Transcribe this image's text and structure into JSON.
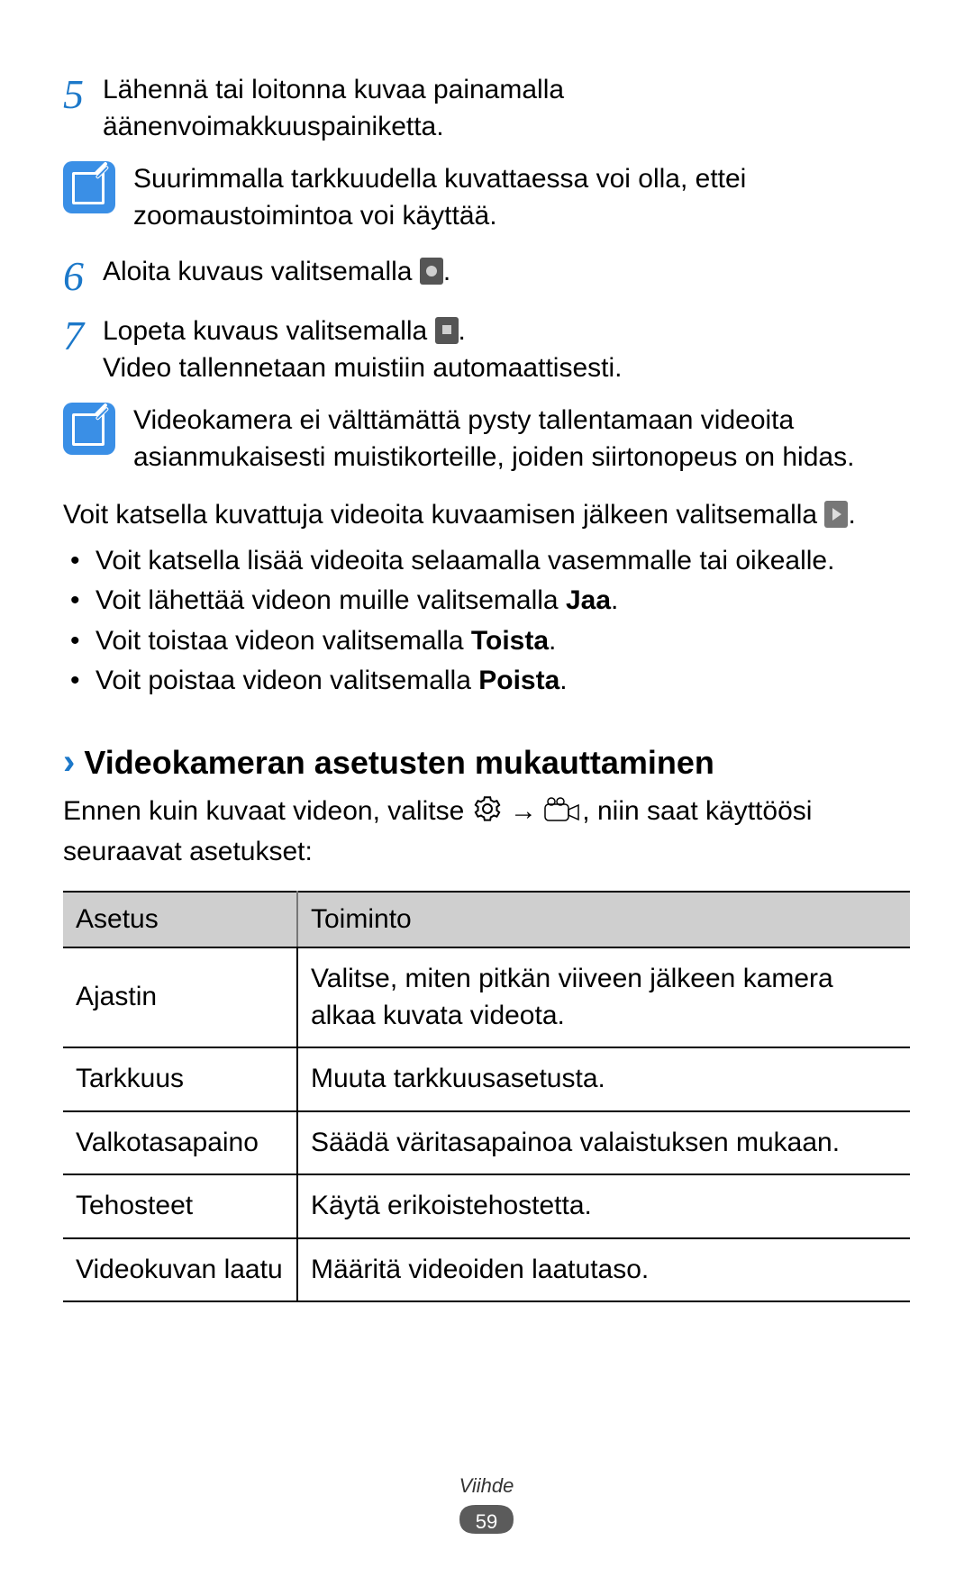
{
  "steps": {
    "s5_num": "5",
    "s5_text": "Lähennä tai loitonna kuvaa painamalla äänenvoimakkuuspainiketta.",
    "note1": "Suurimmalla tarkkuudella kuvattaessa voi olla, ettei zoomaustoimintoa voi käyttää.",
    "s6_num": "6",
    "s6_a": "Aloita kuvaus valitsemalla ",
    "s6_b": ".",
    "s7_num": "7",
    "s7_a": "Lopeta kuvaus valitsemalla ",
    "s7_b": ".",
    "s7_c": "Video tallennetaan muistiin automaattisesti.",
    "note2": "Videokamera ei välttämättä pysty tallentamaan videoita asianmukaisesti muistikorteille, joiden siirtonopeus on hidas."
  },
  "after": {
    "p1a": "Voit katsella kuvattuja videoita kuvaamisen jälkeen valitsemalla ",
    "p1b": ".",
    "b1": "Voit katsella lisää videoita selaamalla vasemmalle tai oikealle.",
    "b2a": "Voit lähettää videon muille valitsemalla ",
    "b2b": "Jaa",
    "b2c": ".",
    "b3a": "Voit toistaa videon valitsemalla ",
    "b3b": "Toista",
    "b3c": ".",
    "b4a": "Voit poistaa videon valitsemalla ",
    "b4b": "Poista",
    "b4c": "."
  },
  "section": {
    "chevron": "›",
    "title": "Videokameran asetusten mukauttaminen",
    "intro_a": "Ennen kuin kuvaat videon, valitse ",
    "intro_arrow": " → ",
    "intro_b": ", niin saat käyttöösi seuraavat asetukset:"
  },
  "table": {
    "h1": "Asetus",
    "h2": "Toiminto",
    "rows": [
      {
        "c1": "Ajastin",
        "c2": "Valitse, miten pitkän viiveen jälkeen kamera alkaa kuvata videota."
      },
      {
        "c1": "Tarkkuus",
        "c2": "Muuta tarkkuusasetusta."
      },
      {
        "c1": "Valkotasapaino",
        "c2": "Säädä väritasapainoa valaistuksen mukaan."
      },
      {
        "c1": "Tehosteet",
        "c2": "Käytä erikoistehostetta."
      },
      {
        "c1": "Videokuvan laatu",
        "c2": "Määritä videoiden laatutaso."
      }
    ]
  },
  "footer": {
    "category": "Viihde",
    "page": "59"
  }
}
